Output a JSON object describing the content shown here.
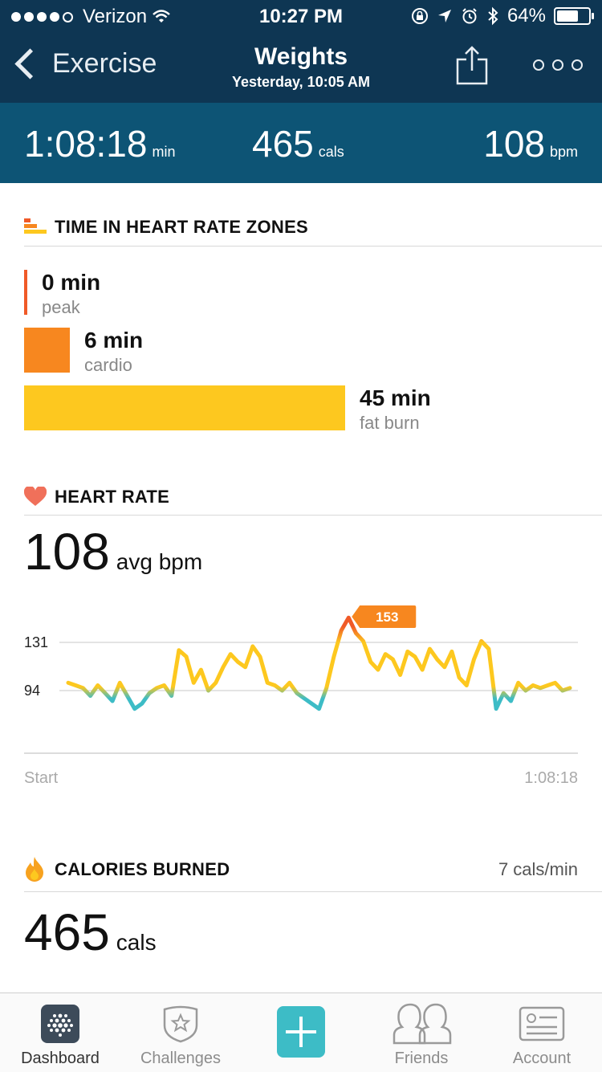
{
  "status_bar": {
    "carrier": "Verizon",
    "time": "10:27 PM",
    "battery": "64%"
  },
  "nav": {
    "back_label": "Exercise",
    "title": "Weights",
    "subtitle": "Yesterday, 10:05 AM",
    "share_icon": "share-icon",
    "more_icon": "more-icon"
  },
  "summary": {
    "duration": {
      "value": "1:08:18",
      "unit": "min"
    },
    "calories": {
      "value": "465",
      "unit": "cals"
    },
    "heart_rate": {
      "value": "108",
      "unit": "bpm"
    }
  },
  "zones": {
    "title": "TIME IN HEART RATE ZONES",
    "items": [
      {
        "value": "0 min",
        "name": "peak",
        "color": "#f05a28",
        "minutes": 0
      },
      {
        "value": "6 min",
        "name": "cardio",
        "color": "#f7871f",
        "minutes": 6
      },
      {
        "value": "45 min",
        "name": "fat burn",
        "color": "#fdc81f",
        "minutes": 45
      }
    ]
  },
  "heart_rate": {
    "title": "HEART RATE",
    "avg_value": "108",
    "avg_unit": "avg bpm",
    "peak_label": "153",
    "start_label": "Start",
    "end_label": "1:08:18"
  },
  "chart_data": {
    "type": "line",
    "ylim": [
      60,
      160
    ],
    "ytick_labels": [
      "131",
      "94"
    ],
    "yticks": [
      131,
      94
    ],
    "x": [
      0,
      1,
      2,
      3,
      4,
      5,
      6,
      7,
      8,
      9,
      10,
      11,
      12,
      13,
      14,
      15,
      16,
      17,
      18,
      19,
      20,
      21,
      22,
      23,
      24,
      25,
      26,
      27,
      28,
      29,
      30,
      31,
      32,
      33,
      34,
      35,
      36,
      37,
      38,
      39,
      40,
      41,
      42,
      43,
      44,
      45,
      46,
      47,
      48,
      49,
      50,
      51,
      52,
      53,
      54,
      55,
      56,
      57,
      58,
      59,
      60,
      61,
      62,
      63,
      64,
      65,
      66,
      67,
      68
    ],
    "series": [
      {
        "values": [
          100,
          98,
          96,
          90,
          98,
          92,
          86,
          100,
          90,
          80,
          84,
          92,
          96,
          98,
          90,
          125,
          120,
          100,
          110,
          94,
          100,
          112,
          122,
          116,
          112,
          128,
          120,
          100,
          98,
          94,
          100,
          92,
          88,
          84,
          80,
          96,
          120,
          140,
          150,
          138,
          132,
          116,
          110,
          122,
          118,
          106,
          124,
          120,
          110,
          126,
          118,
          112,
          124,
          104,
          98,
          118,
          132,
          126,
          80,
          92,
          86,
          100,
          94,
          98,
          96,
          98,
          100,
          94,
          96
        ]
      }
    ],
    "annotations": [
      {
        "x": 38,
        "y": 153,
        "text": "153"
      }
    ]
  },
  "calories": {
    "title": "CALORIES BURNED",
    "rate": "7 cals/min",
    "value": "465",
    "unit": "cals"
  },
  "tabs": [
    {
      "label": "Dashboard",
      "icon": "dashboard-icon",
      "active": true
    },
    {
      "label": "Challenges",
      "icon": "star-badge-icon",
      "active": false
    },
    {
      "label": "",
      "icon": "plus-icon",
      "active": false
    },
    {
      "label": "Friends",
      "icon": "friends-icon",
      "active": false
    },
    {
      "label": "Account",
      "icon": "account-card-icon",
      "active": false
    }
  ],
  "colors": {
    "nav_bg": "#0e3653",
    "summary_bg": "#0d5475",
    "teal": "#3dbcc6",
    "yellow": "#fdc81f",
    "orange": "#f7871f",
    "red_orange": "#f05a28",
    "heart": "#f0705a"
  }
}
